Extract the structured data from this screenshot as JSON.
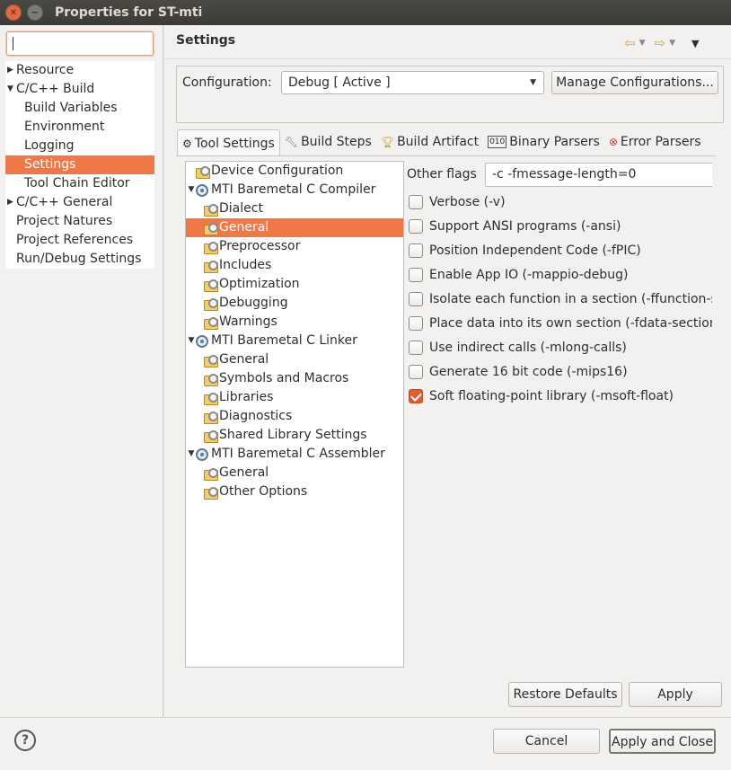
{
  "window": {
    "title": "Properties for ST-mti"
  },
  "filter": {
    "value": ""
  },
  "nav": {
    "items": [
      {
        "label": "Resource"
      },
      {
        "label": "C/C++ Build"
      },
      {
        "label": "Build Variables"
      },
      {
        "label": "Environment"
      },
      {
        "label": "Logging"
      },
      {
        "label": "Settings"
      },
      {
        "label": "Tool Chain Editor"
      },
      {
        "label": "C/C++ General"
      },
      {
        "label": "Project Natures"
      },
      {
        "label": "Project References"
      },
      {
        "label": "Run/Debug Settings"
      }
    ]
  },
  "header": {
    "title": "Settings"
  },
  "config": {
    "label": "Configuration:",
    "value": "Debug  [ Active ]",
    "manage_label": "Manage Configurations..."
  },
  "tabs": [
    {
      "label": "Tool Settings"
    },
    {
      "label": "Build Steps"
    },
    {
      "label": "Build Artifact"
    },
    {
      "label": "Binary Parsers"
    },
    {
      "label": "Error Parsers"
    }
  ],
  "tooltree": {
    "items": [
      {
        "label": "Device Configuration"
      },
      {
        "label": "MTI Baremetal C Compiler"
      },
      {
        "label": "Dialect"
      },
      {
        "label": "General"
      },
      {
        "label": "Preprocessor"
      },
      {
        "label": "Includes"
      },
      {
        "label": "Optimization"
      },
      {
        "label": "Debugging"
      },
      {
        "label": "Warnings"
      },
      {
        "label": "MTI Baremetal C Linker"
      },
      {
        "label": "General"
      },
      {
        "label": "Symbols and Macros"
      },
      {
        "label": "Libraries"
      },
      {
        "label": "Diagnostics"
      },
      {
        "label": "Shared Library Settings"
      },
      {
        "label": "MTI Baremetal C Assembler"
      },
      {
        "label": "General"
      },
      {
        "label": "Other Options"
      }
    ]
  },
  "options": {
    "other_flags_label": "Other flags",
    "other_flags_value": "-c -fmessage-length=0",
    "checkboxes": [
      {
        "label": "Verbose (-v)",
        "checked": false
      },
      {
        "label": "Support ANSI programs (-ansi)",
        "checked": false
      },
      {
        "label": "Position Independent Code (-fPIC)",
        "checked": false
      },
      {
        "label": "Enable App IO (-mappio-debug)",
        "checked": false
      },
      {
        "label": "Isolate each function in a section (-ffunction-se",
        "checked": false
      },
      {
        "label": "Place data into its own section (-fdata-sections",
        "checked": false
      },
      {
        "label": "Use indirect calls (-mlong-calls)",
        "checked": false
      },
      {
        "label": "Generate 16 bit code (-mips16)",
        "checked": false
      },
      {
        "label": "Soft floating-point library (-msoft-float)",
        "checked": true
      }
    ]
  },
  "buttons": {
    "restore": "Restore Defaults",
    "apply": "Apply",
    "cancel": "Cancel",
    "apply_close": "Apply and Close",
    "help": "?"
  },
  "colors": {
    "selection": "#f07746",
    "checkbox_checked": "#e25d2b",
    "titlebar": "#3c3b37"
  }
}
